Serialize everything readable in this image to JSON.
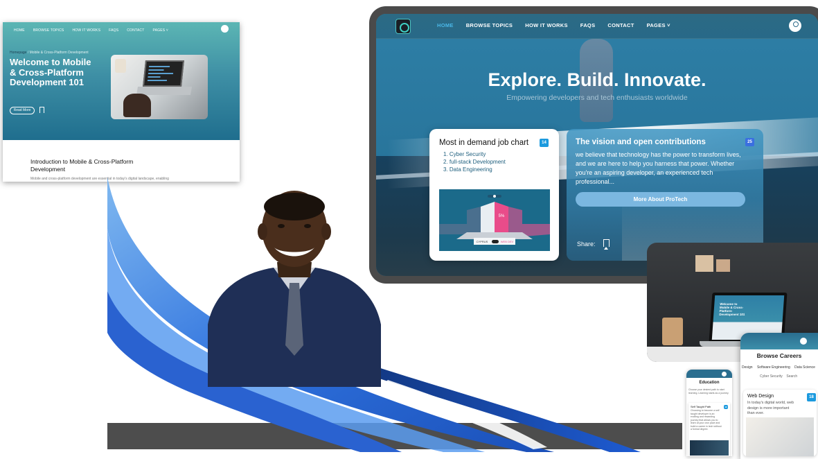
{
  "left_card": {
    "nav_items": [
      "HOME",
      "BROWSE TOPICS",
      "HOW IT WORKS",
      "FAQS",
      "CONTACT",
      "PAGES ˅"
    ],
    "breadcrumb_home": "Homepage",
    "breadcrumb_current": " / Mobile & Cross-Platform Development",
    "title": "Welcome to Mobile & Cross-Platform Development 101",
    "read_more": "Read More",
    "intro_title": "Introduction to Mobile & Cross-Platform Development",
    "intro_body": "Mobile and cross-platform development are essential in today's digital landscape, enabling"
  },
  "monitor": {
    "nav_items": [
      {
        "label": "HOME",
        "active": true
      },
      {
        "label": "BROWSE TOPICS",
        "active": false
      },
      {
        "label": "HOW IT WORKS",
        "active": false
      },
      {
        "label": "FAQS",
        "active": false
      },
      {
        "label": "CONTACT",
        "active": false
      },
      {
        "label": "PAGES ˅",
        "active": false
      }
    ],
    "hero_title": "Explore. Build. Innovate.",
    "hero_subtitle": "Empowering developers and tech enthusiasts worldwide",
    "job_card": {
      "title": "Most in demand job chart",
      "badge": "14",
      "items": [
        "1. Cyber Security",
        "2. full-stack Development",
        "3. Data Engineering"
      ],
      "chart_center_label": "5%",
      "chart_left_label": "CYPRUS",
      "chart_right_label": "WEB DEV"
    },
    "vision_card": {
      "title": "The vision and open contributions",
      "badge": "25",
      "body": "we believe that technology has the power to transform lives, and we are here to help you harness that power. Whether you're an aspiring developer, an experienced tech professional...",
      "button": "More About ProTech",
      "share_label": "Share:"
    }
  },
  "desk_photo": {
    "screen_title": "Welcome to Mobile & Cross-Platform Development 101"
  },
  "phone_careers": {
    "title": "Browse Careers",
    "tabs": [
      "Design",
      "Software Engineering",
      "Data Science"
    ],
    "tabs_row2": [
      "Cyber Security",
      "Search"
    ],
    "card_title": "Web Design",
    "card_badge": "18",
    "card_body": "In today's digital world, web design is more important than ever."
  },
  "phone_education": {
    "title": "Education",
    "intro": "Choose your desired path to start learning. Learning starts as a journey.",
    "card_title": "Self Taught Path",
    "card_badge": "12",
    "card_body": "Choosing to become a self taught developer is an exciting and rewarding journey that allows you to learn at your own pace and build a career in tech without a formal degree."
  },
  "colors": {
    "accent": "#1c9ade",
    "nav_active": "#4ab8e8",
    "monitor_frame": "#4a4a4a",
    "screen_bg": "#2a789f",
    "button_bg": "#7bb7e0",
    "swoosh": "#1f5fd0"
  }
}
